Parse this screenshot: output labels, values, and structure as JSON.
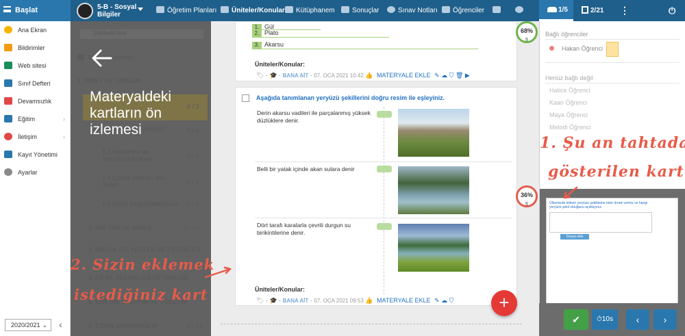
{
  "topbar": {
    "brand": "Başlat",
    "class_name": "5-B - Sosyal Bilgiler",
    "nav": [
      "Öğretim Planları",
      "Üniteler/Konular",
      "Kütüphanem",
      "Sonuçlar",
      "Sınav Notları",
      "Öğrenciler"
    ],
    "right_tab1": "1/5",
    "right_tab2": "2/21"
  },
  "sidebar": {
    "items": [
      {
        "label": "Ana Ekran",
        "icon": "star-icon",
        "color": "#f5b400"
      },
      {
        "label": "Bildirimler",
        "icon": "mail-icon",
        "color": "#f39c12"
      },
      {
        "label": "Web sitesi",
        "icon": "home-icon",
        "color": "#1a8f5a"
      },
      {
        "label": "Sınıf Defteri",
        "icon": "notebook-icon",
        "color": "#2a77ad"
      },
      {
        "label": "Devamsızlık",
        "icon": "user-minus-icon",
        "color": "#e04848"
      },
      {
        "label": "Eğitim",
        "icon": "grid-icon",
        "color": "#2a77ad"
      },
      {
        "label": "İletişim",
        "icon": "chat-icon",
        "color": "#e04848"
      },
      {
        "label": "Kayıt Yönetimi",
        "icon": "pencil-icon",
        "color": "#2a77ad"
      },
      {
        "label": "Ayarlar",
        "icon": "gear-icon",
        "color": "#8a8a8a"
      }
    ],
    "year": "2020/2021"
  },
  "overlay": {
    "search_placeholder": "Sayfada ara",
    "heading": "Ders Gösterimi",
    "units": [
      {
        "label": "1. BİREY VE TOPLUM"
      },
      {
        "label": "0 / 3"
      },
      {
        "label": "Gurubumuzu Tanıyalım"
      },
      {
        "label": "0 / 4"
      },
      {
        "label": "1.2 Konuşmamız Sonuçları"
      },
      {
        "label": "1.3 Haklarımı ve Sorumluluklarımı"
      },
      {
        "label": "0 / 3"
      },
      {
        "label": "1.4 Çocuk Hakları Her Yerde"
      },
      {
        "label": "0 / 3"
      },
      {
        "label": "1.5 Ünite Değerlendirmesi"
      },
      {
        "label": "0 / 2"
      },
      {
        "label": "2. KÜLTÜR VE MİRAS"
      },
      {
        "label": "0 / 17"
      },
      {
        "label": "3. İNSANLAR, YERLER VE ÇEVRELER"
      },
      {
        "label": "4. BİLİM, TEKNOLOJİ VE TOPLUM"
      },
      {
        "label": "5. ÜRETİM, DAĞITIM VE TÜKETİM"
      },
      {
        "label": "6. ETKİN VATANDAŞLIK"
      },
      {
        "label": "0 / 13"
      }
    ],
    "preview": "Materyaldeki kartların ön izlemesi"
  },
  "card1": {
    "rows": [
      {
        "n": "1.",
        "t": "Gül"
      },
      {
        "n": "2.",
        "t": "Plato"
      },
      {
        "n": "3.",
        "t": "Akarsu"
      }
    ],
    "topics_label": "Üniteler/Konular:",
    "tag": "BANA AİT",
    "date": "07. OCA 2021 10:42",
    "add": "MATERYALE EKLE",
    "percent": "68%",
    "count": "5"
  },
  "card2": {
    "question": "Aşağıda tanımlanan yeryüzü şekillerini doğru resim ile eşleyiniz.",
    "items": [
      {
        "text": "Derin akarsu vadileri ile parçalanmış yüksek düzlüklere denir."
      },
      {
        "text": "Belli bir yatak içinde akan sulara denir"
      },
      {
        "text": "Dört tarafı karalarla çevrili durgun su birikintilerine denir."
      }
    ],
    "topics_label": "Üniteler/Konular:",
    "tag": "BANA AİT",
    "date": "07. OCA 2021 09:53",
    "add": "MATERYALE EKLE",
    "percent": "36%",
    "count": "5"
  },
  "annotations": {
    "a1_line1": "1. Şu an tahtada",
    "a1_line2": "gösterilen kart",
    "a2_line1": "2. Sizin eklemek",
    "a2_line2": "istediğiniz kart"
  },
  "rpanel": {
    "connected_label": "Bağlı öğrenciler",
    "connected": [
      "Hakan Öğrenci"
    ],
    "not_connected_label": "Henüz bağlı değil",
    "not_connected": [
      "Hatice Öğrenci",
      "Kaan Öğrenci",
      "Maya Öğrenci",
      "Melodi Öğrenci"
    ],
    "thumb_question": "Ülkemizde bilinen yeryüzü şekillerine birer örnek veriniz ve hangi yeryüzü şekli olduğunu açıklayınız.",
    "thumb_button": "Dosya ekle",
    "timer": "10s"
  },
  "colors": {
    "primary": "#1f5f8b",
    "accent": "#1f6fc3",
    "red": "#e53935",
    "green": "#43a047"
  }
}
